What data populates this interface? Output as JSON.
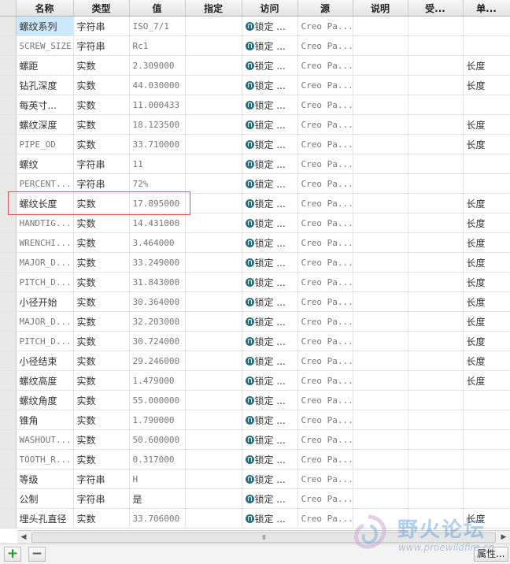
{
  "columns": [
    "名称",
    "类型",
    "值",
    "指定",
    "访问",
    "源",
    "说明",
    "受...",
    "单..."
  ],
  "rows": [
    {
      "name": "螺纹系列",
      "type": "字符串",
      "value": "ISO_7/1",
      "access": "锁定 ...",
      "source": "Creo Pa...",
      "unit": ""
    },
    {
      "name": "SCREW_SIZE",
      "type": "字符串",
      "value": "Rc1",
      "access": "锁定 ...",
      "source": "Creo Pa...",
      "unit": ""
    },
    {
      "name": "螺距",
      "type": "实数",
      "value": "2.309000",
      "access": "锁定 ...",
      "source": "Creo Pa...",
      "unit": "长度"
    },
    {
      "name": "钻孔深度",
      "type": "实数",
      "value": "44.030000",
      "access": "锁定 ...",
      "source": "Creo Pa...",
      "unit": "长度"
    },
    {
      "name": "每英寸...",
      "type": "实数",
      "value": "11.000433",
      "access": "锁定 ...",
      "source": "Creo Pa...",
      "unit": ""
    },
    {
      "name": "螺纹深度",
      "type": "实数",
      "value": "18.123500",
      "access": "锁定 ...",
      "source": "Creo Pa...",
      "unit": "长度"
    },
    {
      "name": "PIPE_OD",
      "type": "实数",
      "value": "33.710000",
      "access": "锁定 ...",
      "source": "Creo Pa...",
      "unit": "长度"
    },
    {
      "name": "螺纹",
      "type": "字符串",
      "value": "11",
      "access": "锁定 ...",
      "source": "Creo Pa...",
      "unit": ""
    },
    {
      "name": "PERCENT...",
      "type": "字符串",
      "value": "72%",
      "access": "锁定 ...",
      "source": "Creo Pa...",
      "unit": ""
    },
    {
      "name": "螺纹长度",
      "type": "实数",
      "value": "17.895000",
      "access": "锁定 ...",
      "source": "Creo Pa...",
      "unit": "长度"
    },
    {
      "name": "HANDTIG...",
      "type": "实数",
      "value": "14.431000",
      "access": "锁定 ...",
      "source": "Creo Pa...",
      "unit": "长度"
    },
    {
      "name": "WRENCHI...",
      "type": "实数",
      "value": "3.464000",
      "access": "锁定 ...",
      "source": "Creo Pa...",
      "unit": "长度"
    },
    {
      "name": "MAJOR_D...",
      "type": "实数",
      "value": "33.249000",
      "access": "锁定 ...",
      "source": "Creo Pa...",
      "unit": "长度"
    },
    {
      "name": "PITCH_D...",
      "type": "实数",
      "value": "31.843000",
      "access": "锁定 ...",
      "source": "Creo Pa...",
      "unit": "长度"
    },
    {
      "name": "小径开始",
      "type": "实数",
      "value": "30.364000",
      "access": "锁定 ...",
      "source": "Creo Pa...",
      "unit": "长度"
    },
    {
      "name": "MAJOR_D...",
      "type": "实数",
      "value": "32.203000",
      "access": "锁定 ...",
      "source": "Creo Pa...",
      "unit": "长度"
    },
    {
      "name": "PITCH_D...",
      "type": "实数",
      "value": "30.724000",
      "access": "锁定 ...",
      "source": "Creo Pa...",
      "unit": "长度"
    },
    {
      "name": "小径结束",
      "type": "实数",
      "value": "29.246000",
      "access": "锁定 ...",
      "source": "Creo Pa...",
      "unit": "长度"
    },
    {
      "name": "螺纹高度",
      "type": "实数",
      "value": "1.479000",
      "access": "锁定 ...",
      "source": "Creo Pa...",
      "unit": "长度"
    },
    {
      "name": "螺纹角度",
      "type": "实数",
      "value": "55.000000",
      "access": "锁定 ...",
      "source": "Creo Pa...",
      "unit": ""
    },
    {
      "name": "锥角",
      "type": "实数",
      "value": "1.790000",
      "access": "锁定 ...",
      "source": "Creo Pa...",
      "unit": ""
    },
    {
      "name": "WASHOUT...",
      "type": "实数",
      "value": "50.600000",
      "access": "锁定 ...",
      "source": "Creo Pa...",
      "unit": ""
    },
    {
      "name": "TOOTH_R...",
      "type": "实数",
      "value": "0.317000",
      "access": "锁定 ...",
      "source": "Creo Pa...",
      "unit": ""
    },
    {
      "name": "等级",
      "type": "字符串",
      "value": "H",
      "access": "锁定 ...",
      "source": "Creo Pa...",
      "unit": ""
    },
    {
      "name": "公制",
      "type": "字符串",
      "value": "是",
      "access": "锁定 ...",
      "source": "Creo Pa...",
      "unit": ""
    },
    {
      "name": "埋头孔直径",
      "type": "实数",
      "value": "33.706000",
      "access": "锁定 ...",
      "source": "Creo Pa...",
      "unit": "长度"
    }
  ],
  "selected_row": 0,
  "highlighted_row": 9,
  "scrollbar": {
    "grip": "III"
  },
  "footer": {
    "add_label": "+",
    "remove_label": "−",
    "properties_label": "属性..."
  },
  "watermark": {
    "title": "野火论坛",
    "url": "www.proewildfire.cn"
  },
  "icons": {
    "access": "lock-icon",
    "add": "plus-icon",
    "remove": "minus-icon"
  },
  "colors": {
    "selection": "#cce8fb",
    "highlight_box": "#d9534f",
    "add_button": "#1a9b1a",
    "lock": "#2f6d78"
  }
}
